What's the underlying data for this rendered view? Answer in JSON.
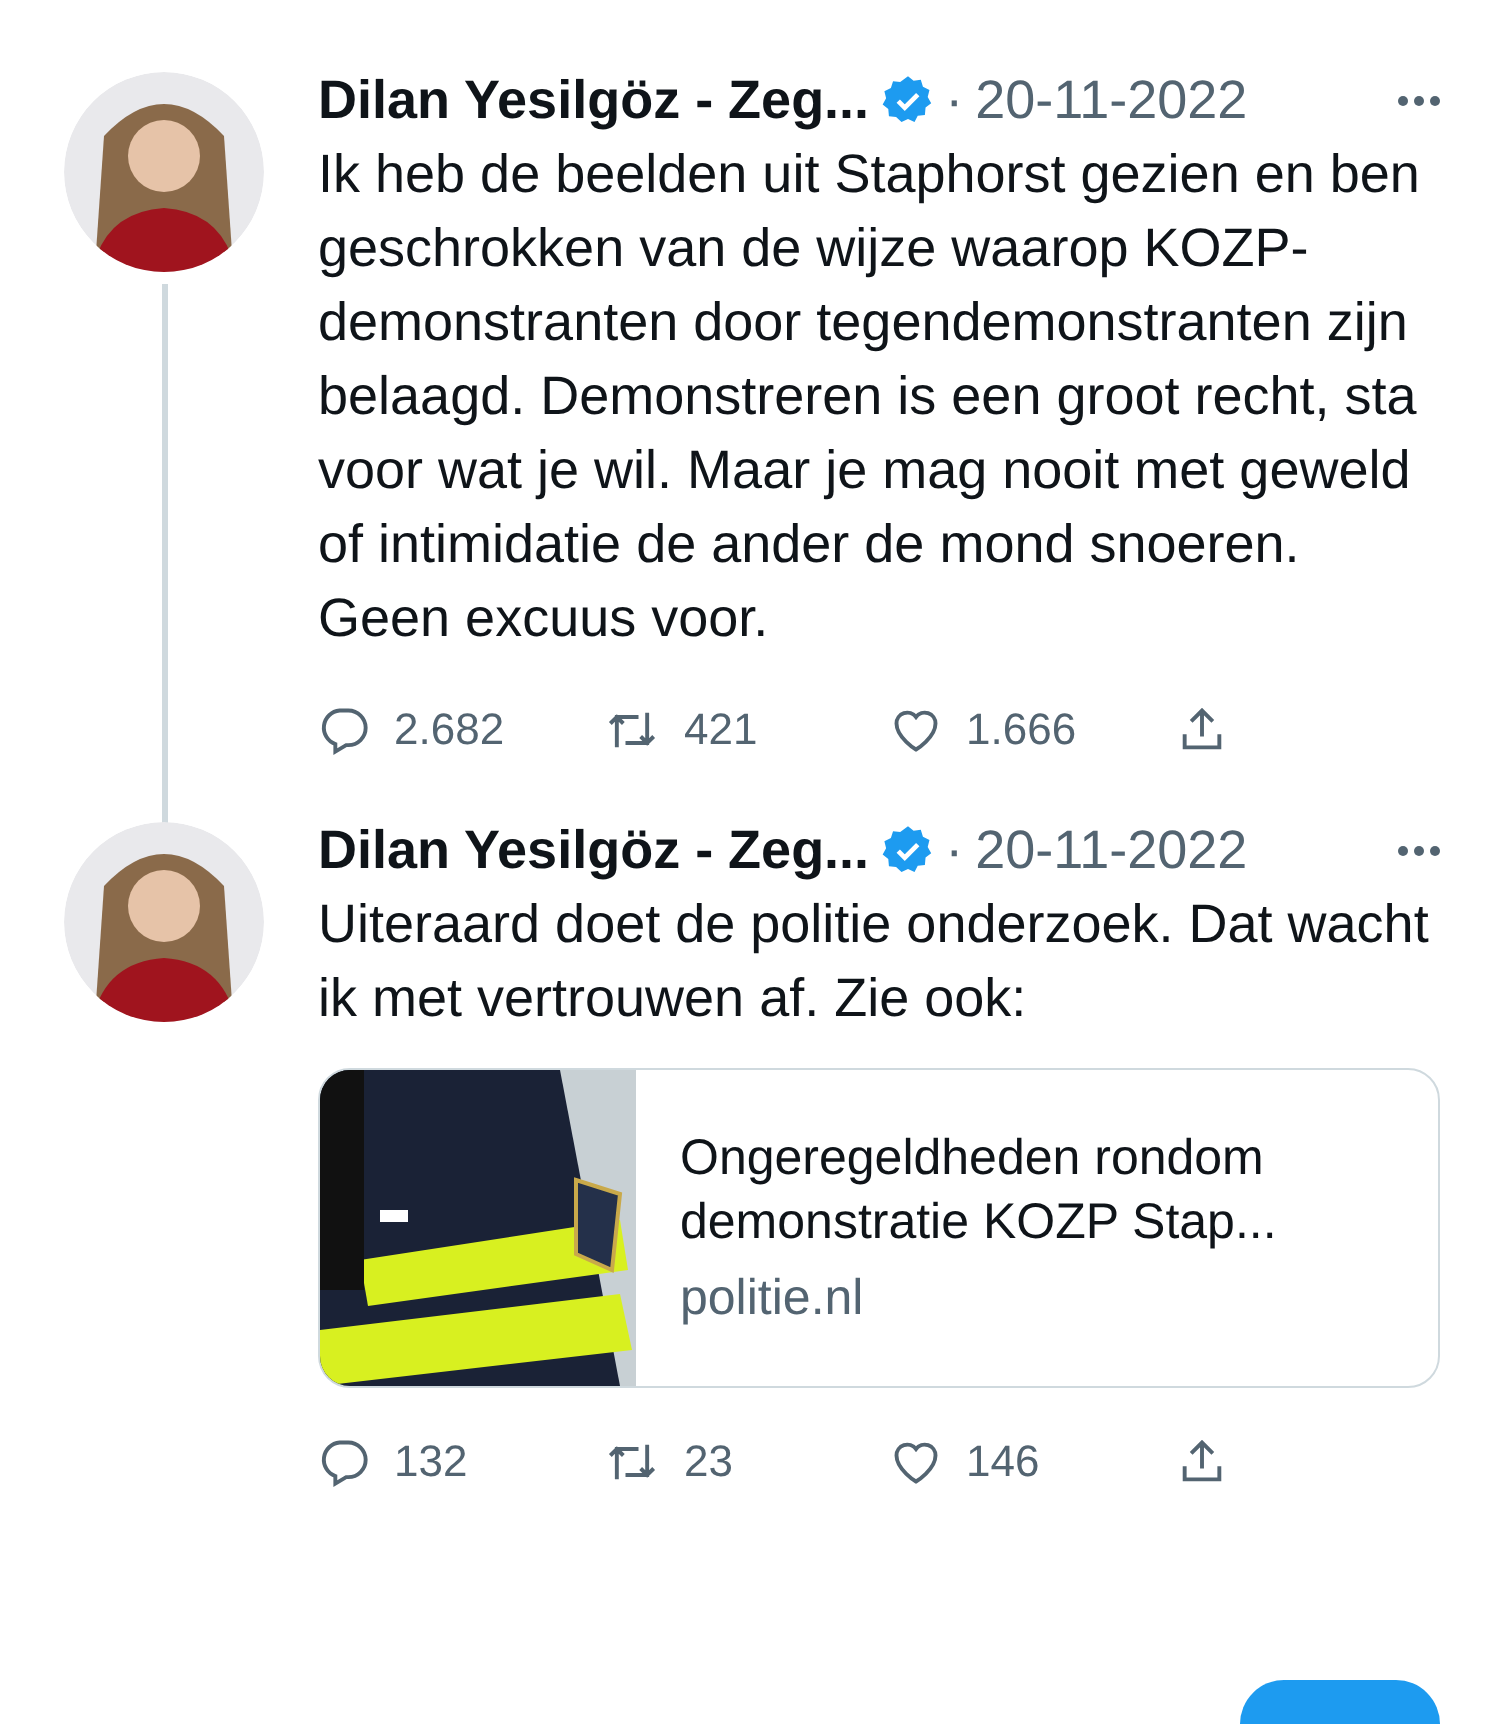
{
  "tweets": [
    {
      "author": "Dilan Yesilgöz - Zeg...",
      "verified": true,
      "separator": "·",
      "date": "20-11-2022",
      "text": "Ik heb de beelden uit Staphorst gezien en ben geschrokken van de wijze waarop KOZP-demonstranten door tegendemonstranten zijn belaagd. Demonstreren is een groot recht, sta voor wat je wil. Maar je mag nooit met geweld of intimidatie de ander de mond snoeren. Geen excuus voor.",
      "thread_line": true,
      "replies": "2.682",
      "retweets": "421",
      "likes": "1.666"
    },
    {
      "author": "Dilan Yesilgöz - Zeg...",
      "verified": true,
      "separator": "·",
      "date": "20-11-2022",
      "text": "Uiteraard doet de politie onderzoek. Dat wacht ik met vertrouwen af. Zie ook:",
      "thread_line": false,
      "card": {
        "kind": "picture",
        "title": "Ongeregeldheden rondom demonstratie KOZP Stap...",
        "domain": "politie.nl"
      },
      "replies": "132",
      "retweets": "23",
      "likes": "146"
    }
  ],
  "compose_button": true
}
